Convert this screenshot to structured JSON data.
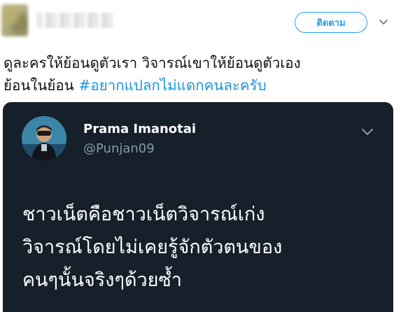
{
  "header": {
    "follow_label": "ติดตาม"
  },
  "tweet": {
    "line1": "ดูละครให้ย้อนดูตัวเรา วิจารณ์เขาให้ย้อนดูตัวเอง",
    "line2_text": "ย้อนในย้อน ",
    "hashtag": "#อยากแปลกไม่แดกคนละครับ"
  },
  "quoted": {
    "name": "Prama Imanotai",
    "handle": "@Punjan09",
    "lines": [
      "ชาวเน็ตคือชาวเน็ตวิจารณ์เก่ง",
      "วิจารณ์โดยไม่เคยรู้จักตัวตนของ",
      "คนๆนั้นจริงๆด้วยซ้ำ"
    ]
  },
  "colors": {
    "accent": "#1da1f2",
    "hashtag": "#1b95e0",
    "dark_card": "#15202b",
    "muted": "#8899a6"
  },
  "icons": [
    "chevron-down-icon",
    "more-chevron-icon"
  ]
}
